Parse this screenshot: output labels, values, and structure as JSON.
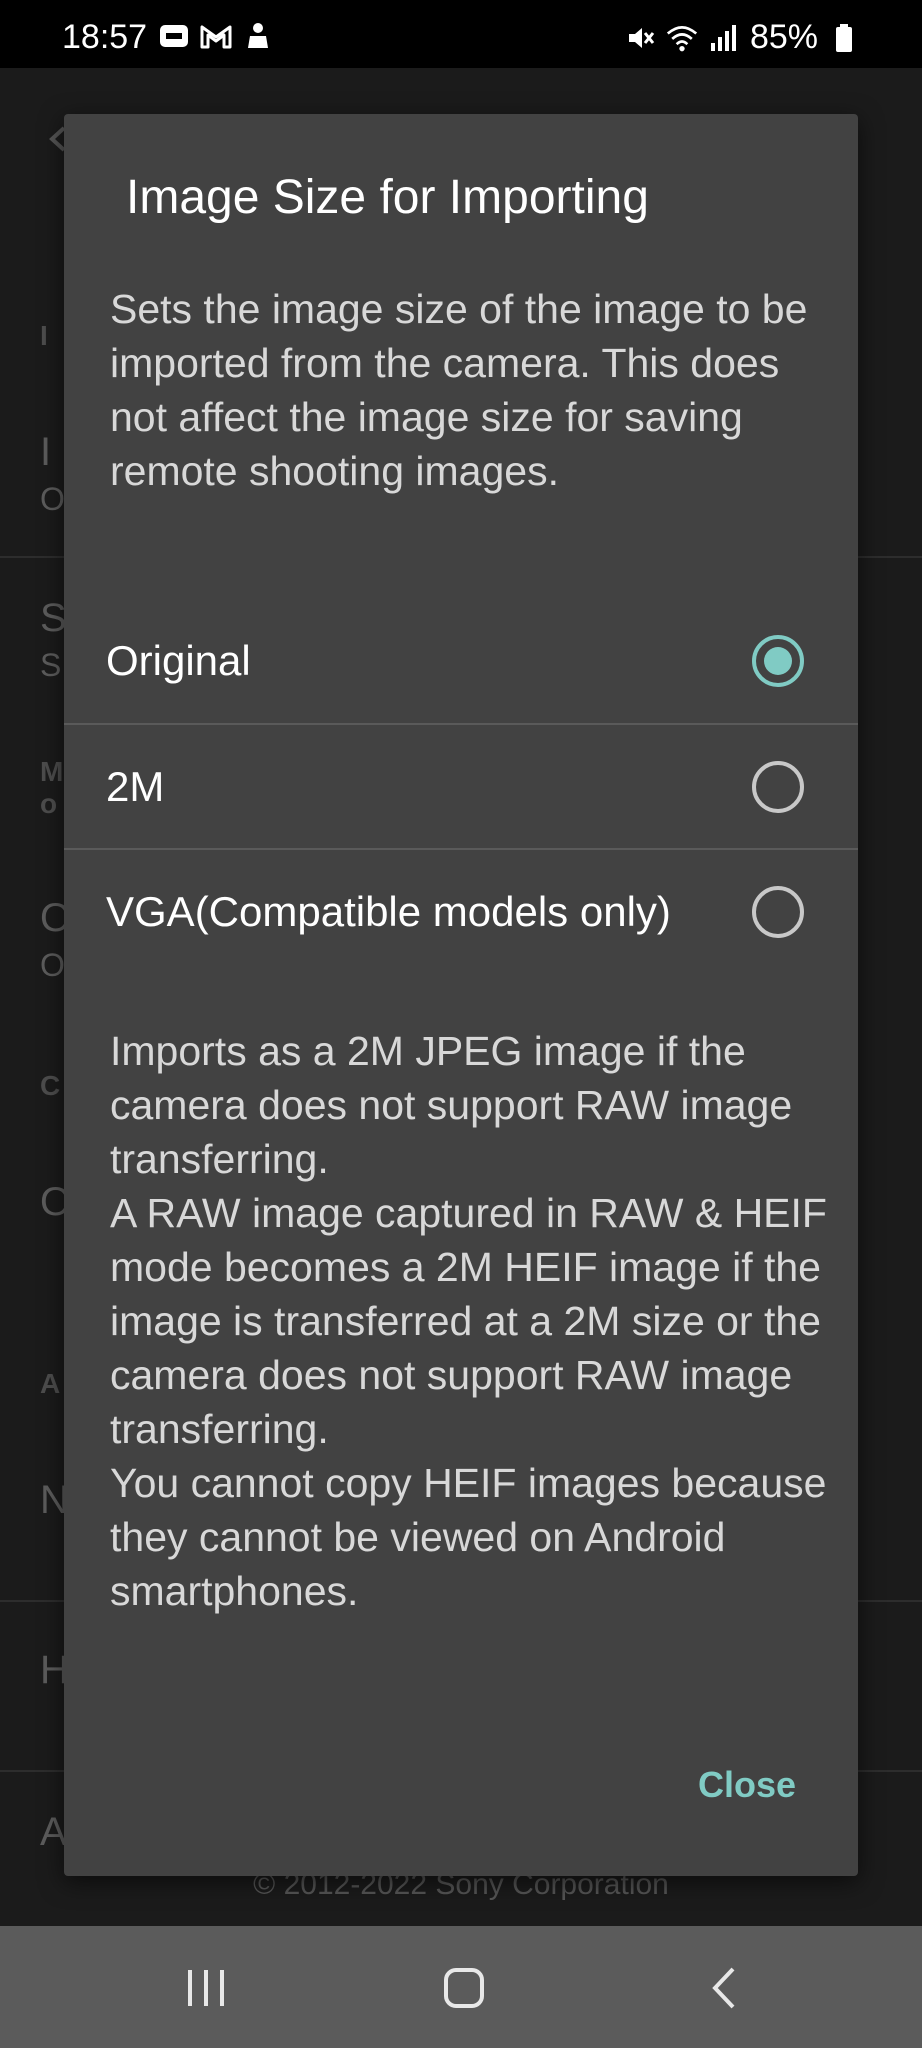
{
  "status_bar": {
    "time": "18:57",
    "left_icons": [
      "notification-icon",
      "gmail-icon",
      "android-robot-icon"
    ],
    "right_icons": [
      "mute-icon",
      "wifi-icon",
      "signal-icon",
      "battery-icon"
    ],
    "battery": "85%"
  },
  "background": {
    "copyright": "© 2012-2022 Sony Corporation"
  },
  "dialog": {
    "title": "Image Size for Importing",
    "description": "Sets the image size of the image to be imported from the camera. This does not affect the image size for saving remote shooting images.",
    "options": [
      {
        "label": "Original",
        "selected": true
      },
      {
        "label": "2M",
        "selected": false
      },
      {
        "label": "VGA(Compatible models only)",
        "selected": false
      }
    ],
    "note": "Imports as a 2M JPEG image if the camera does not support RAW image transferring.\nA RAW image captured in RAW & HEIF mode becomes a 2M HEIF image if the image is transferred at a 2M size or the camera does not support RAW image transferring.\nYou cannot copy HEIF images because they cannot be viewed on Android smartphones.",
    "close_label": "Close"
  },
  "nav_bar": {
    "icons": [
      "recent-apps-icon",
      "home-icon",
      "back-icon"
    ]
  },
  "colors": {
    "accent": "#80cbc4",
    "dialog_bg": "#424242",
    "nav_bg": "#5b5b5b"
  }
}
